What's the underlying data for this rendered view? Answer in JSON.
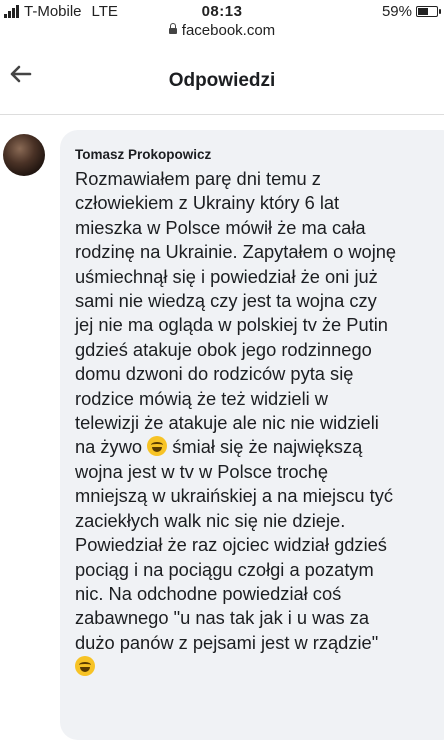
{
  "status_bar": {
    "carrier": "T-Mobile",
    "network": "LTE",
    "time": "08:13",
    "battery": "59%",
    "battery_level": 0.59
  },
  "browser": {
    "url": "facebook.com"
  },
  "header": {
    "title": "Odpowiedzi"
  },
  "comment": {
    "author": "Tomasz Prokopowicz",
    "lines": [
      "Rozmawiałem parę dni temu z",
      "człowiekiem z Ukrainy który 6 lat",
      "mieszka w Polsce mówił że ma cała",
      "rodzinę na Ukrainie. Zapytałem o wojnę",
      "uśmiechnął się i powiedział że oni już",
      "sami nie wiedzą czy jest ta wojna czy",
      "jej nie ma ogląda w polskiej tv że Putin",
      "gdzieś atakuje obok jego rodzinnego",
      "domu dzwoni do rodziców pyta się",
      "rodzice mówią że też widzieli w",
      "telewizji że atakuje ale nic nie widzieli",
      "na żywo",
      "śmiał się że największą",
      "wojna jest w tv w Polsce trochę",
      "mniejszą w ukraińskiej a na miejscu tyć",
      "zaciekłych walk nic się nie dzieje.",
      "Powiedział że raz ojciec widział gdzieś",
      "pociąg i na pociągu czołgi a pozatym",
      "nic. Na odchodne powiedział coś",
      "zabawnego \"u nas tak jak i u was za",
      "dużo panów z pejsami jest w rządzie\""
    ],
    "emoji": "laughing-emoji"
  }
}
